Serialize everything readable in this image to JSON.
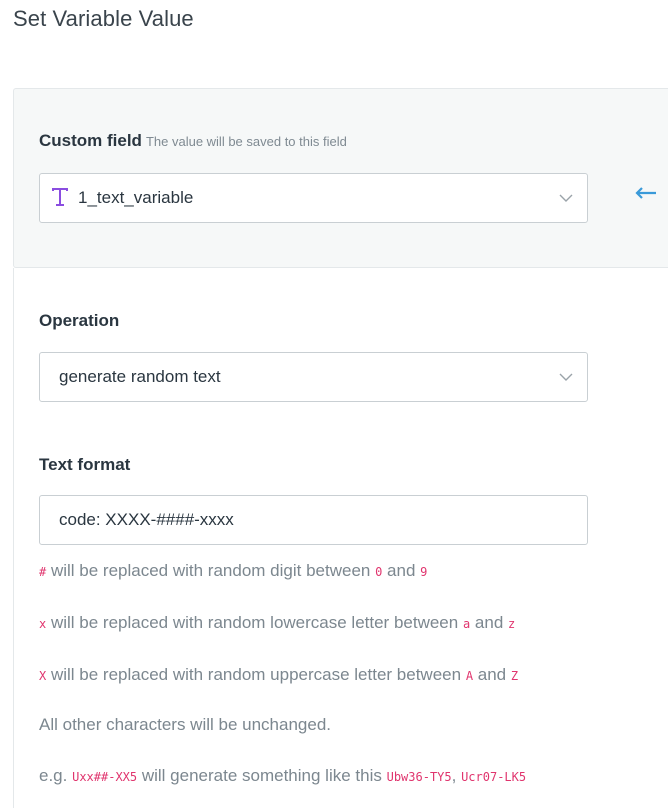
{
  "page": {
    "title": "Set Variable Value"
  },
  "custom_field": {
    "label": "Custom field",
    "hint": "The value will be saved to this field",
    "selected": "1_text_variable",
    "icon": "text-type-icon"
  },
  "operation": {
    "label": "Operation",
    "selected": "generate random text"
  },
  "text_format": {
    "label": "Text format",
    "value": "code: XXXX-####-xxxx"
  },
  "help": {
    "digit": {
      "code": "#",
      "text": " will be replaced with random digit between ",
      "from": "0",
      "and": " and ",
      "to": "9"
    },
    "lower": {
      "code": "x",
      "text": " will be replaced with random lowercase letter between ",
      "from": "a",
      "and": " and ",
      "to": "z"
    },
    "upper": {
      "code": "X",
      "text": " will be replaced with random uppercase letter between ",
      "from": "A",
      "and": " and ",
      "to": "Z"
    },
    "other": "All other characters will be unchanged.",
    "example": {
      "prefix": "e.g. ",
      "pattern": "Uxx##-XX5",
      "middle": " will generate something like this ",
      "ex1": "Ubw36-TY5",
      "sep": ", ",
      "ex2": "Ucr07-LK5"
    }
  },
  "colors": {
    "accent": "#8a4de0",
    "code": "#e0356e",
    "arrow": "#3a9ad9"
  }
}
